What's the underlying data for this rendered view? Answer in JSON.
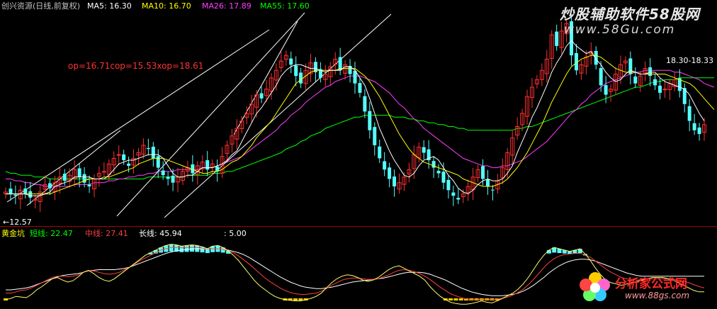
{
  "colors": {
    "bg": "#000000",
    "up": "#ff3030",
    "down": "#54ffff",
    "ma5": "#ffffff",
    "ma10": "#ffff00",
    "ma26": "#ff40ff",
    "ma55": "#00ff00",
    "header_text": "#c0c0c0",
    "separator": "#aa0000",
    "annotation": "#ff3333",
    "trendline": "#ffffff"
  },
  "main": {
    "stock_title": "创兴资源(日线,前复权)",
    "ma5_label": "MA5: 16.30",
    "ma10_label": "MA10: 16.70",
    "ma26_label": "MA26: 17.89",
    "ma55_label": "MA55: 17.60",
    "op_text": "op=16.71cop=15.53xop=18.61",
    "low_label": "←12.57",
    "price_label": "18.30-18.33"
  },
  "sub": {
    "indicator_title": "黄金坑",
    "short_label": "短线: 22.47",
    "mid_label": "中线: 27.41",
    "long_label": "长线: 45.94",
    "extra_label": ": 5.00"
  },
  "watermarks": {
    "top_cn": "炒股辅助软件58股网",
    "top_url": "www.58Gu.com",
    "bottom_cn": "分析家公式网",
    "bottom_url": "www.88gs.com"
  },
  "chart_data": [
    {
      "type": "candlestick",
      "title": "创兴资源(日线,前复权)",
      "series": [
        {
          "name": "MA5",
          "last": 16.3
        },
        {
          "name": "MA10",
          "last": 16.7
        },
        {
          "name": "MA26",
          "last": 17.89
        },
        {
          "name": "MA55",
          "last": 17.6
        }
      ],
      "annotations": [
        "op=16.71cop=15.53xop=18.61",
        "←12.57",
        "18.30-18.33"
      ],
      "close": [
        13.1,
        13.0,
        12.9,
        13.2,
        13.0,
        12.8,
        12.7,
        13.1,
        13.5,
        13.3,
        13.6,
        13.9,
        13.7,
        14.0,
        14.3,
        13.9,
        13.6,
        13.4,
        13.8,
        14.1,
        14.2,
        14.6,
        14.9,
        15.1,
        14.8,
        14.5,
        14.9,
        15.2,
        15.6,
        15.4,
        14.9,
        14.4,
        14.0,
        13.8,
        13.6,
        13.9,
        14.2,
        14.4,
        14.1,
        14.5,
        14.7,
        14.3,
        14.6,
        14.2,
        15.0,
        15.6,
        16.1,
        16.5,
        16.9,
        17.3,
        17.8,
        18.3,
        18.1,
        18.6,
        19.2,
        19.6,
        20.1,
        20.4,
        19.9,
        19.3,
        18.9,
        19.6,
        20.0,
        19.5,
        19.2,
        19.4,
        19.8,
        20.2,
        19.6,
        19.9,
        19.4,
        18.9,
        18.4,
        17.4,
        16.4,
        15.6,
        14.9,
        14.3,
        13.8,
        13.4,
        13.6,
        13.9,
        14.3,
        15.1,
        15.5,
        15.2,
        14.8,
        14.4,
        14.1,
        13.6,
        13.2,
        12.9,
        12.7,
        13.0,
        13.4,
        13.9,
        14.3,
        13.8,
        13.4,
        13.2,
        13.7,
        14.4,
        15.2,
        16.0,
        16.6,
        17.3,
        18.2,
        18.7,
        19.1,
        19.6,
        20.2,
        21.5,
        20.9,
        21.7,
        22.1,
        20.4,
        19.6,
        19.9,
        20.3,
        20.6,
        19.9,
        18.8,
        18.3,
        18.6,
        19.4,
        19.9,
        20.1,
        19.4,
        18.9,
        19.3,
        19.7,
        19.3,
        18.8,
        18.4,
        18.6,
        18.9,
        19.1,
        18.5,
        17.8,
        16.9,
        16.4,
        16.2,
        16.7
      ],
      "ma5": [
        13.0,
        13.0,
        13.0,
        13.0,
        13.0,
        12.9,
        12.9,
        12.9,
        13.0,
        13.1,
        13.4,
        13.5,
        13.6,
        13.7,
        13.9,
        13.9,
        13.9,
        13.9,
        13.8,
        13.8,
        13.8,
        14.0,
        14.3,
        14.6,
        14.7,
        14.8,
        14.8,
        14.9,
        15.0,
        15.1,
        15.1,
        15.1,
        14.9,
        14.5,
        14.1,
        13.9,
        13.9,
        14.0,
        14.0,
        14.2,
        14.4,
        14.4,
        14.4,
        14.5,
        14.6,
        14.8,
        15.1,
        15.3,
        15.8,
        16.3,
        16.8,
        17.3,
        17.6,
        18.0,
        18.4,
        18.8,
        19.3,
        19.6,
        19.8,
        19.9,
        19.9,
        19.8,
        19.7,
        19.7,
        19.6,
        19.5,
        19.6,
        19.6,
        19.6,
        19.8,
        19.8,
        19.6,
        19.2,
        18.8,
        18.1,
        17.3,
        16.5,
        15.9,
        15.3,
        14.8,
        14.4,
        14.0,
        13.9,
        14.1,
        14.5,
        14.8,
        14.9,
        15.0,
        14.8,
        14.4,
        14.0,
        13.7,
        13.3,
        13.1,
        13.0,
        13.2,
        13.5,
        13.7,
        13.8,
        13.7,
        13.7,
        13.8,
        14.1,
        14.5,
        15.2,
        15.8,
        16.4,
        17.1,
        17.6,
        18.2,
        18.8,
        19.5,
        20.0,
        20.4,
        20.9,
        21.2,
        20.9,
        20.7,
        20.5,
        20.6,
        20.2,
        19.9,
        19.5,
        19.2,
        19.0,
        19.1,
        19.4,
        19.6,
        19.5,
        19.4,
        19.4,
        19.5,
        19.5,
        19.2,
        19.0,
        18.9,
        18.8,
        18.7,
        18.6,
        18.3,
        17.8,
        17.3,
        16.9
      ],
      "ma10": [
        13.0,
        13.0,
        13.0,
        13.0,
        13.0,
        13.0,
        13.0,
        13.0,
        13.0,
        13.0,
        13.1,
        13.2,
        13.3,
        13.4,
        13.5,
        13.6,
        13.7,
        13.8,
        13.8,
        13.8,
        13.9,
        13.9,
        14.0,
        14.1,
        14.2,
        14.3,
        14.4,
        14.6,
        14.7,
        14.8,
        14.9,
        14.9,
        14.9,
        14.8,
        14.7,
        14.6,
        14.5,
        14.4,
        14.3,
        14.2,
        14.1,
        14.1,
        14.2,
        14.2,
        14.3,
        14.5,
        14.7,
        14.8,
        15.0,
        15.3,
        15.6,
        16.0,
        16.3,
        16.6,
        16.9,
        17.3,
        17.7,
        18.1,
        18.5,
        18.9,
        19.1,
        19.3,
        19.5,
        19.6,
        19.6,
        19.6,
        19.6,
        19.6,
        19.7,
        19.7,
        19.7,
        19.7,
        19.5,
        19.3,
        19.0,
        18.6,
        18.2,
        17.7,
        17.2,
        16.7,
        16.2,
        15.8,
        15.4,
        15.1,
        14.9,
        14.7,
        14.6,
        14.5,
        14.4,
        14.3,
        14.2,
        14.1,
        14.0,
        13.8,
        13.7,
        13.6,
        13.5,
        13.4,
        13.4,
        13.4,
        13.5,
        13.6,
        13.8,
        14.1,
        14.4,
        14.8,
        15.2,
        15.7,
        16.2,
        16.7,
        17.3,
        17.9,
        18.4,
        18.9,
        19.4,
        19.8,
        20.0,
        20.2,
        20.3,
        20.4,
        20.4,
        20.3,
        20.1,
        19.9,
        19.7,
        19.6,
        19.5,
        19.5,
        19.5,
        19.4,
        19.4,
        19.4,
        19.4,
        19.4,
        19.4,
        19.3,
        19.2,
        19.1,
        19.0,
        18.9,
        18.7,
        18.4,
        18.1,
        17.8,
        17.5
      ],
      "ma26": [
        13.8,
        13.8,
        13.7,
        13.7,
        13.6,
        13.6,
        13.5,
        13.5,
        13.4,
        13.4,
        13.4,
        13.4,
        13.4,
        13.4,
        13.5,
        13.5,
        13.5,
        13.5,
        13.6,
        13.6,
        13.6,
        13.7,
        13.7,
        13.8,
        13.8,
        13.9,
        13.9,
        14.0,
        14.0,
        14.1,
        14.1,
        14.2,
        14.2,
        14.2,
        14.2,
        14.3,
        14.3,
        14.3,
        14.3,
        14.3,
        14.4,
        14.4,
        14.4,
        14.5,
        14.6,
        14.7,
        14.8,
        14.9,
        15.0,
        15.2,
        15.4,
        15.6,
        15.8,
        16.0,
        16.2,
        16.4,
        16.7,
        16.9,
        17.2,
        17.4,
        17.6,
        17.9,
        18.1,
        18.3,
        18.5,
        18.7,
        18.8,
        19.0,
        19.1,
        19.2,
        19.3,
        19.3,
        19.3,
        19.2,
        19.1,
        19.0,
        18.8,
        18.6,
        18.4,
        18.1,
        17.8,
        17.6,
        17.3,
        17.0,
        16.8,
        16.5,
        16.3,
        16.1,
        15.9,
        15.7,
        15.5,
        15.3,
        15.1,
        14.9,
        14.8,
        14.7,
        14.6,
        14.5,
        14.5,
        14.4,
        14.4,
        14.5,
        14.5,
        14.6,
        14.7,
        14.8,
        15.0,
        15.2,
        15.4,
        15.6,
        15.8,
        16.1,
        16.4,
        16.7,
        17.0,
        17.3,
        17.5,
        17.8,
        18.0,
        18.3,
        18.5,
        18.7,
        18.9,
        19.0,
        19.1,
        19.2,
        19.3,
        19.4,
        19.5,
        19.5,
        19.6,
        19.6,
        19.6,
        19.6,
        19.6,
        19.6,
        19.5,
        19.5,
        19.4,
        19.3,
        19.2,
        19.1,
        18.9,
        18.8,
        18.7
      ],
      "ma55": [
        14.2,
        14.1,
        14.1,
        14.0,
        14.0,
        14.0,
        13.9,
        13.9,
        13.9,
        13.8,
        13.8,
        13.8,
        13.8,
        13.8,
        13.8,
        13.8,
        13.8,
        13.8,
        13.8,
        13.8,
        13.8,
        13.8,
        13.8,
        13.8,
        13.8,
        13.8,
        13.8,
        13.8,
        13.8,
        13.9,
        13.9,
        13.9,
        13.9,
        13.9,
        13.9,
        13.9,
        13.9,
        14.0,
        14.0,
        14.0,
        14.0,
        14.0,
        14.1,
        14.1,
        14.1,
        14.2,
        14.2,
        14.3,
        14.4,
        14.5,
        14.6,
        14.7,
        14.8,
        14.9,
        15.0,
        15.1,
        15.2,
        15.4,
        15.5,
        15.6,
        15.8,
        15.9,
        16.1,
        16.2,
        16.3,
        16.5,
        16.6,
        16.7,
        16.8,
        16.9,
        17.0,
        17.1,
        17.1,
        17.2,
        17.2,
        17.2,
        17.2,
        17.2,
        17.2,
        17.1,
        17.1,
        17.1,
        17.0,
        17.0,
        16.9,
        16.9,
        16.8,
        16.8,
        16.7,
        16.7,
        16.6,
        16.6,
        16.5,
        16.5,
        16.4,
        16.4,
        16.4,
        16.4,
        16.4,
        16.4,
        16.4,
        16.4,
        16.4,
        16.4,
        16.5,
        16.5,
        16.6,
        16.6,
        16.7,
        16.8,
        16.9,
        17.0,
        17.1,
        17.2,
        17.3,
        17.4,
        17.5,
        17.6,
        17.7,
        17.8,
        17.9,
        18.0,
        18.1,
        18.2,
        18.3,
        18.4,
        18.5,
        18.6,
        18.7,
        18.7,
        18.8,
        18.9,
        19.0,
        19.0,
        19.1,
        19.1,
        19.1,
        19.2,
        19.2,
        19.2,
        19.2,
        19.2,
        19.2,
        19.2,
        19.2
      ]
    },
    {
      "type": "line",
      "title": "黄金坑",
      "series": [
        {
          "name": "短线",
          "last": 22.47
        },
        {
          "name": "中线",
          "last": 27.41
        },
        {
          "name": "长线",
          "last": 45.94
        }
      ],
      "short": [
        10,
        12,
        15,
        14,
        13,
        18,
        25,
        30,
        36,
        42,
        44,
        40,
        37,
        39,
        45,
        52,
        55,
        50,
        44,
        40,
        38,
        42,
        48,
        54,
        60,
        66,
        72,
        78,
        82,
        86,
        90,
        93,
        95,
        94,
        92,
        93,
        94,
        93,
        91,
        88,
        92,
        93,
        90,
        85,
        78,
        70,
        60,
        50,
        40,
        32,
        26,
        20,
        15,
        12,
        10,
        9,
        8,
        8,
        10,
        12,
        15,
        20,
        28,
        36,
        42,
        46,
        48,
        47,
        44,
        40,
        38,
        40,
        44,
        50,
        56,
        60,
        62,
        58,
        54,
        50,
        46,
        40,
        30,
        22,
        15,
        10,
        6,
        4,
        3,
        3,
        4,
        6,
        8,
        6,
        5,
        8,
        12,
        16,
        20,
        26,
        34,
        44,
        56,
        68,
        78,
        86,
        90,
        88,
        86,
        84,
        86,
        88,
        80,
        70,
        58,
        48,
        40,
        36,
        34,
        32,
        34,
        36,
        38,
        40,
        42,
        44,
        44,
        44,
        42,
        40,
        36,
        32,
        28,
        24,
        22,
        22
      ],
      "mid": [
        20,
        20,
        22,
        24,
        25,
        28,
        32,
        36,
        40,
        44,
        46,
        46,
        45,
        46,
        48,
        52,
        54,
        54,
        52,
        50,
        49,
        50,
        52,
        56,
        60,
        65,
        70,
        74,
        78,
        82,
        86,
        88,
        90,
        90,
        90,
        90,
        90,
        90,
        89,
        88,
        88,
        88,
        87,
        85,
        82,
        77,
        71,
        65,
        58,
        51,
        44,
        38,
        33,
        28,
        24,
        21,
        19,
        18,
        18,
        19,
        20,
        23,
        27,
        32,
        36,
        40,
        42,
        43,
        43,
        42,
        41,
        41,
        42,
        45,
        48,
        52,
        55,
        56,
        55,
        53,
        50,
        46,
        41,
        35,
        29,
        24,
        19,
        16,
        13,
        11,
        10,
        10,
        10,
        10,
        10,
        11,
        12,
        14,
        17,
        21,
        26,
        33,
        41,
        50,
        59,
        67,
        73,
        77,
        79,
        80,
        81,
        81,
        79,
        75,
        69,
        63,
        57,
        52,
        48,
        44,
        42,
        41,
        40,
        41,
        41,
        42,
        42,
        42,
        42,
        41,
        40,
        38,
        36,
        33,
        30,
        28
      ],
      "long": [
        25,
        25,
        26,
        27,
        28,
        30,
        33,
        36,
        39,
        42,
        45,
        47,
        48,
        49,
        50,
        52,
        54,
        55,
        56,
        56,
        56,
        56,
        57,
        58,
        60,
        63,
        66,
        69,
        72,
        75,
        78,
        81,
        83,
        85,
        86,
        87,
        88,
        88,
        88,
        88,
        88,
        88,
        87,
        86,
        84,
        82,
        79,
        75,
        70,
        65,
        60,
        55,
        50,
        45,
        41,
        37,
        34,
        31,
        29,
        28,
        27,
        27,
        28,
        29,
        31,
        33,
        35,
        37,
        38,
        39,
        40,
        41,
        42,
        43,
        45,
        47,
        49,
        51,
        52,
        52,
        52,
        51,
        49,
        46,
        43,
        40,
        36,
        32,
        28,
        25,
        22,
        20,
        18,
        17,
        16,
        16,
        16,
        17,
        18,
        20,
        23,
        27,
        32,
        38,
        44,
        51,
        57,
        62,
        66,
        69,
        71,
        72,
        72,
        71,
        69,
        66,
        63,
        60,
        57,
        54,
        51,
        49,
        47,
        46,
        46,
        46,
        46,
        46,
        46,
        46,
        46,
        46,
        46,
        46,
        46,
        46
      ]
    }
  ]
}
